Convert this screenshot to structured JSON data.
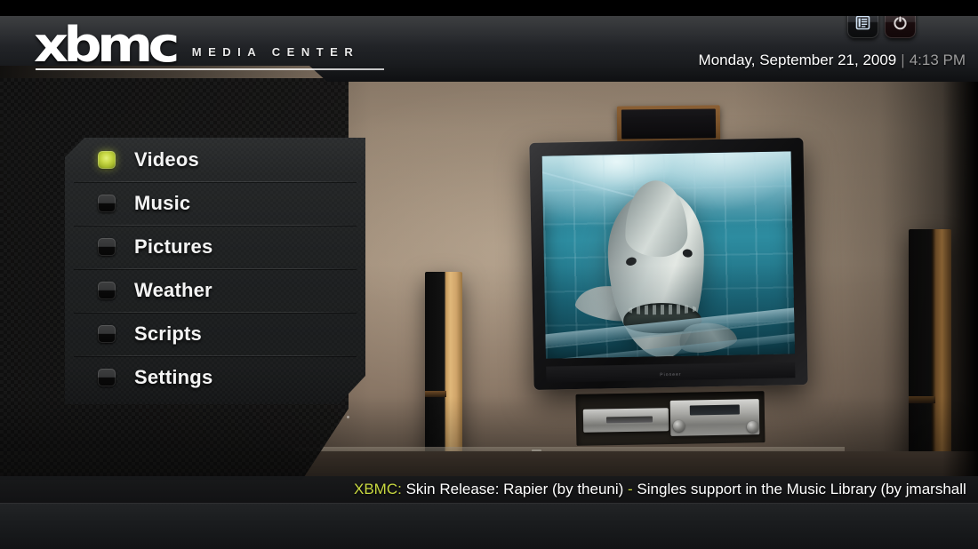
{
  "app": {
    "logo_mark": "xbmc",
    "logo_subtitle": "MEDIA CENTER"
  },
  "header": {
    "date": "Monday, September 21, 2009",
    "separator": "|",
    "time": "4:13 PM"
  },
  "main_menu": {
    "items": [
      {
        "label": "Videos",
        "selected": true,
        "bullet_icon": "bullet-active-icon"
      },
      {
        "label": "Music",
        "selected": false,
        "bullet_icon": "bullet-icon"
      },
      {
        "label": "Pictures",
        "selected": false,
        "bullet_icon": "bullet-icon"
      },
      {
        "label": "Weather",
        "selected": false,
        "bullet_icon": "bullet-icon"
      },
      {
        "label": "Scripts",
        "selected": false,
        "bullet_icon": "bullet-icon"
      },
      {
        "label": "Settings",
        "selected": false,
        "bullet_icon": "bullet-icon"
      }
    ]
  },
  "rss": {
    "tag": "XBMC:",
    "text_1": " Skin Release: Rapier (by theuni) ",
    "dash": "-",
    "text_2": " Singles support in the Music Library (by jmarshall"
  },
  "bottom_bar": {
    "buttons": [
      {
        "name": "favourites-button",
        "icon": "list-icon"
      },
      {
        "name": "shutdown-button",
        "icon": "power-icon"
      }
    ]
  },
  "background": {
    "description": "Home theatre room: wall-mounted flat screen TV showing a great white shark underwater beside a dive cage, centre speaker above, two tower speakers, AV components in a wall niche",
    "tv_brand": "Pioneer"
  },
  "colors": {
    "accent": "#c8d840",
    "text_primary": "#ffffff",
    "text_dim": "#9d9d9d",
    "panel": "#1d1f20",
    "power_red": "#b03030"
  }
}
